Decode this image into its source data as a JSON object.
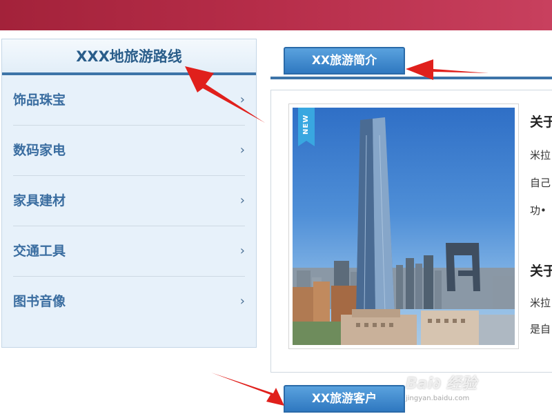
{
  "sidebar": {
    "title": "XXX地旅游路线",
    "items": [
      {
        "label": "饰品珠宝",
        "chevron": "›"
      },
      {
        "label": "数码家电",
        "chevron": "›"
      },
      {
        "label": "家具建材",
        "chevron": "›"
      },
      {
        "label": "交通工具",
        "chevron": "›"
      },
      {
        "label": "图书音像",
        "chevron": "›"
      }
    ]
  },
  "main": {
    "intro_tab": "XX旅游简介",
    "customers_tab": "XX旅游客户",
    "photo": {
      "badge": "NEW"
    },
    "side_text": {
      "heading1": "关于",
      "line1": "米拉",
      "line2": "自己",
      "line3": "功•",
      "heading2": "关于",
      "line4": "米拉",
      "line5": "是自"
    }
  },
  "watermark": {
    "brand": "Bai∂ 经验",
    "url": "jingyan.baidu.com"
  },
  "colors": {
    "banner": "#b52c48",
    "accent_blue": "#3d74a8",
    "tab_blue": "#2f78c0",
    "panel_bg": "#e7f1fa",
    "arrow_red": "#e0201c"
  }
}
